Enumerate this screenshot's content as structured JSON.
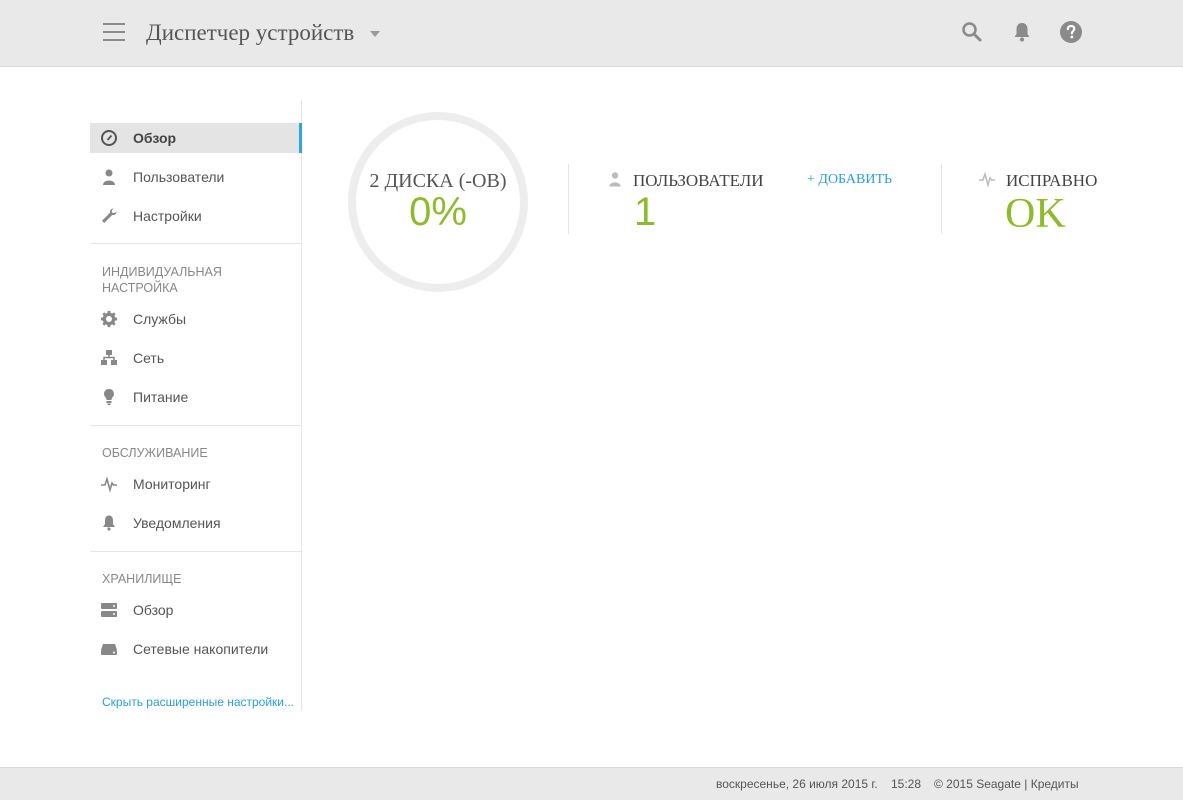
{
  "header": {
    "title": "Диспетчер устройств",
    "icons": [
      "menu-icon",
      "search-icon",
      "bell-icon",
      "help-icon"
    ]
  },
  "sidebar": {
    "items": [
      {
        "label": "Обзор",
        "icon": "dashboard-icon",
        "active": true
      },
      {
        "label": "Пользователи",
        "icon": "user-icon"
      },
      {
        "label": "Настройки",
        "icon": "wrench-icon"
      },
      {
        "label": "Службы",
        "icon": "gear-icon"
      },
      {
        "label": "Сеть",
        "icon": "network-icon"
      },
      {
        "label": "Питание",
        "icon": "bulb-icon"
      },
      {
        "label": "Мониторинг",
        "icon": "pulse-icon"
      },
      {
        "label": "Уведомления",
        "icon": "bell-icon"
      },
      {
        "label": "Обзор",
        "icon": "storage-icon"
      },
      {
        "label": "Сетевые накопители",
        "icon": "nas-icon"
      }
    ],
    "sections": {
      "custom_line1": "Индивидуальная",
      "custom_line2": "настройка",
      "maintenance": "Обслуживание",
      "storage": "Хранилище"
    },
    "hide_link": "Скрыть расширенные настройки..."
  },
  "main": {
    "disks": {
      "label": "2 ДИСКА (-ОВ)",
      "value": "0%",
      "used_fraction": 0
    },
    "users": {
      "title": "Пользователи",
      "value": "1",
      "add_label": "+ Добавить"
    },
    "health": {
      "title": "Исправно",
      "value": "OK"
    }
  },
  "footer": {
    "date": "воскресенье, 26 июля 2015 г.",
    "time": "15:28",
    "copyright": "© 2015 Seagate",
    "separator": "|",
    "credits": "Кредиты"
  },
  "colors": {
    "accent": "#2aa6e0",
    "value_green": "#8dbb2c",
    "header_bg": "#e9e9e9"
  }
}
